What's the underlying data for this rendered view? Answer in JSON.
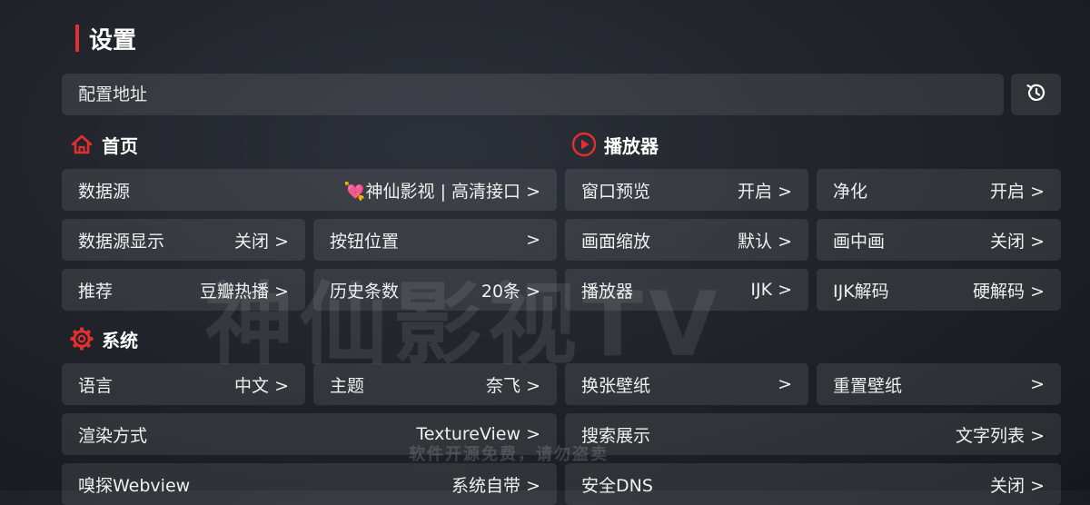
{
  "page": {
    "title": "设置"
  },
  "config": {
    "address_placeholder": "配置地址"
  },
  "sections": {
    "home": {
      "label": "首页"
    },
    "player": {
      "label": "播放器"
    },
    "system": {
      "label": "系统"
    }
  },
  "home_items": [
    {
      "label": "数据源",
      "value": "💘神仙影视 | 高清接口 >"
    },
    {
      "label": "数据源显示",
      "value": "关闭 >"
    },
    {
      "label": "按钮位置",
      "value": ">"
    },
    {
      "label": "推荐",
      "value": "豆瓣热播 >"
    },
    {
      "label": "历史条数",
      "value": "20条 >"
    }
  ],
  "player_items": [
    {
      "label": "窗口预览",
      "value": "开启 >"
    },
    {
      "label": "净化",
      "value": "开启 >"
    },
    {
      "label": "画面缩放",
      "value": "默认 >"
    },
    {
      "label": "画中画",
      "value": "关闭 >"
    },
    {
      "label": "播放器",
      "value": "IJK >"
    },
    {
      "label": "IJK解码",
      "value": "硬解码 >"
    }
  ],
  "system_items": [
    {
      "label": "语言",
      "value": "中文 >"
    },
    {
      "label": "主题",
      "value": "奈飞 >"
    },
    {
      "label": "换张壁纸",
      "value": ">"
    },
    {
      "label": "重置壁纸",
      "value": ">"
    },
    {
      "label": "渲染方式",
      "value": "TextureView >"
    },
    {
      "label": "搜索展示",
      "value": "文字列表 >"
    },
    {
      "label": "嗅探Webview",
      "value": "系统自带 >"
    },
    {
      "label": "安全DNS",
      "value": "关闭 >"
    }
  ],
  "watermark": {
    "main": "神仙影视TV",
    "sub": "软件开源免费，请勿盗卖"
  },
  "colors": {
    "accent": "#e0312f",
    "card_bg": "rgba(255,255,255,0.09)",
    "text": "#f2f2f2"
  },
  "icons": {
    "history": "history-icon",
    "home": "home-icon",
    "player": "play-circle-icon",
    "system": "gear-icon"
  }
}
